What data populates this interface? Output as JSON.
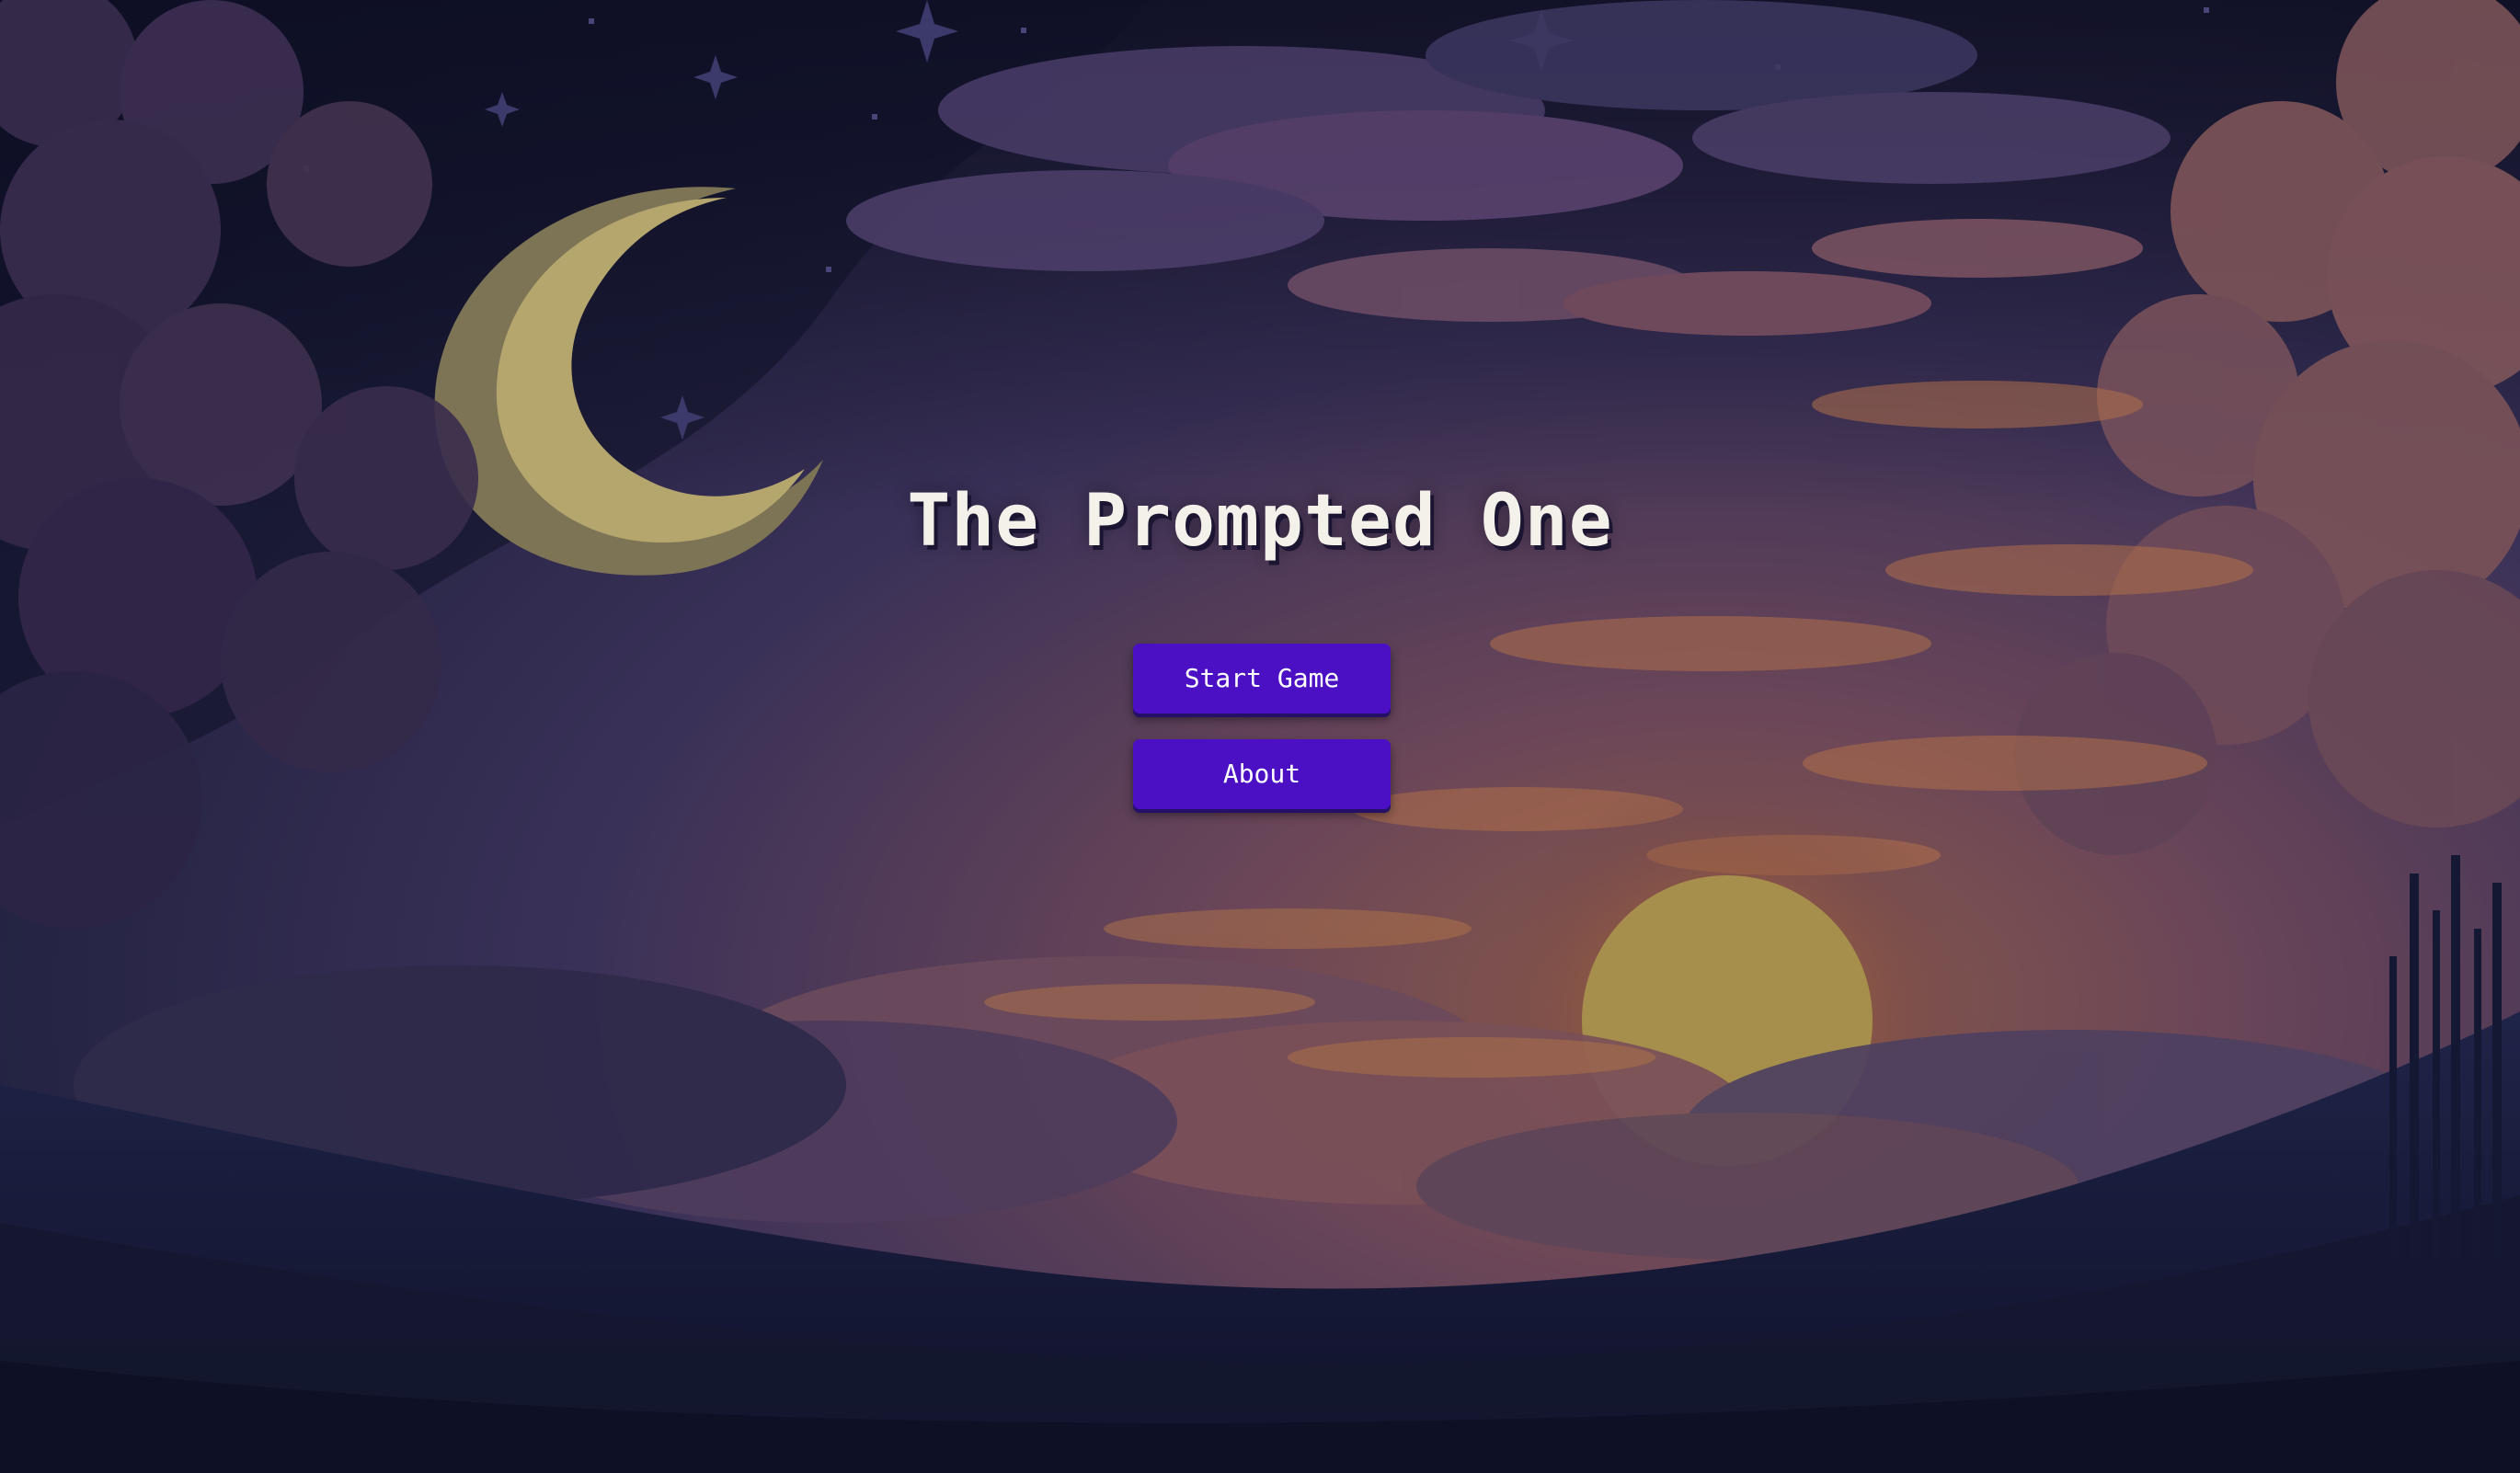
{
  "game": {
    "title": "The Prompted One"
  },
  "menu": {
    "start_label": "Start Game",
    "about_label": "About"
  },
  "colors": {
    "button": "#4b0fc4",
    "title_text": "#f4f1ea",
    "sky_top": "#171a33",
    "sunset_glow": "#8a5240",
    "moon": "#b5a66e",
    "sun": "#a68f4c"
  },
  "icons": {
    "moon": "crescent-moon-icon",
    "sun": "sun-icon",
    "stars": "star-icon"
  }
}
